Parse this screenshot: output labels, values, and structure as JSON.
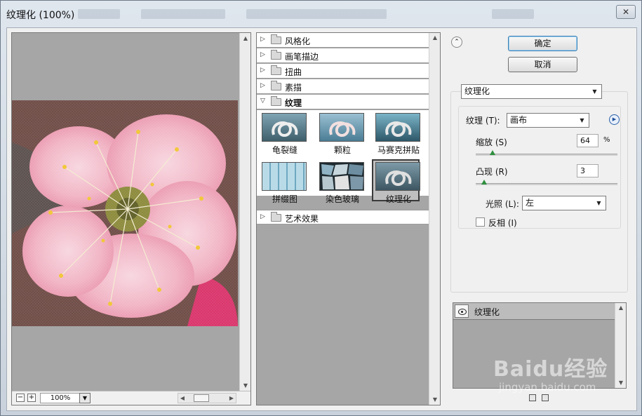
{
  "window": {
    "title": "纹理化 (100%)",
    "close_label": "✕"
  },
  "preview": {
    "zoom_value": "100%",
    "zoom_out_label": "−",
    "zoom_in_label": "+"
  },
  "gallery": {
    "categories": [
      {
        "label": "风格化",
        "expanded": false
      },
      {
        "label": "画笔描边",
        "expanded": false
      },
      {
        "label": "扭曲",
        "expanded": false
      },
      {
        "label": "素描",
        "expanded": false
      },
      {
        "label": "纹理",
        "expanded": true
      },
      {
        "label": "艺术效果",
        "expanded": false
      }
    ],
    "texture_filters": [
      {
        "label": "龟裂缝",
        "selected": false
      },
      {
        "label": "颗粒",
        "selected": false
      },
      {
        "label": "马赛克拼贴",
        "selected": false
      },
      {
        "label": "拼缀图",
        "selected": false
      },
      {
        "label": "染色玻璃",
        "selected": false
      },
      {
        "label": "纹理化",
        "selected": true
      }
    ]
  },
  "buttons": {
    "ok_label": "确定",
    "cancel_label": "取消"
  },
  "filter_select": {
    "value": "纹理化"
  },
  "params": {
    "texture_label": "纹理 (T):",
    "texture_value": "画布",
    "scale_label": "缩放 (S)",
    "scale_value": "64",
    "scale_unit": "%",
    "scale_fraction": 0.12,
    "relief_label": "凸现 (R)",
    "relief_value": "3",
    "relief_fraction": 0.06,
    "light_label": "光照 (L):",
    "light_value": "左",
    "invert_label": "反相 (I)",
    "invert_checked": false
  },
  "layers": {
    "items": [
      {
        "label": "纹理化",
        "visible": true
      }
    ]
  },
  "watermark": {
    "text": "Baidu经验",
    "url_text": "jingyan.baidu.com"
  },
  "colors": {
    "accent": "#3c7fb1",
    "panel_gray": "#a6a6a6",
    "slider_knob": "#2f8f3f"
  }
}
